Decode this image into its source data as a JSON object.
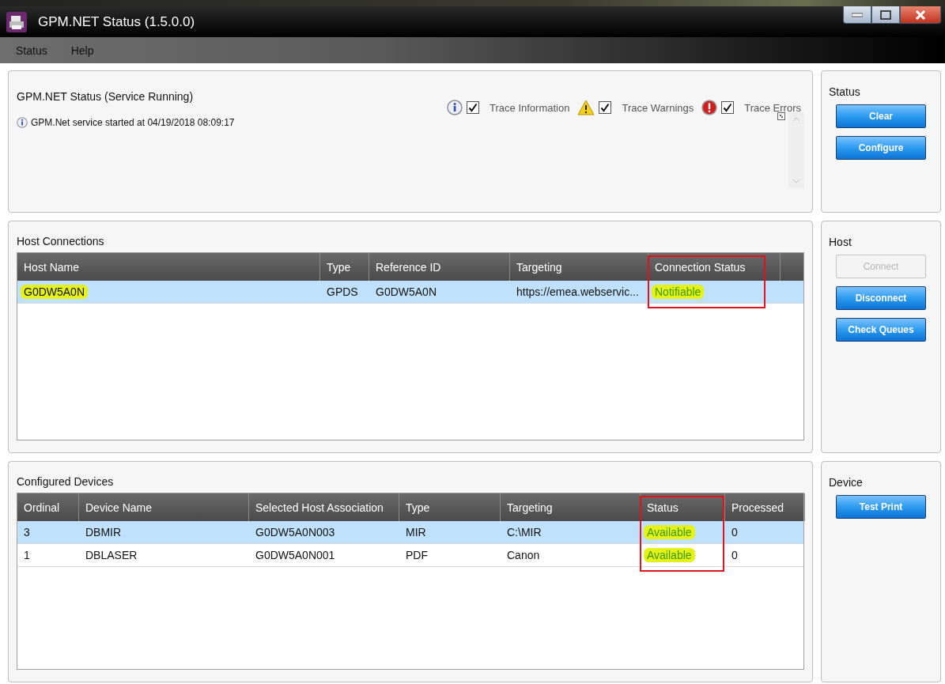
{
  "window": {
    "title": "GPM.NET Status (1.5.0.0)"
  },
  "menu": [
    "Status",
    "Help"
  ],
  "status_panel": {
    "title": "GPM.NET Status (Service Running)",
    "traces": [
      {
        "kind": "info",
        "label": "Trace Information",
        "checked": true
      },
      {
        "kind": "warning",
        "label": "Trace Warnings",
        "checked": true
      },
      {
        "kind": "error",
        "label": "Trace Errors",
        "checked": true
      }
    ],
    "log": [
      {
        "kind": "info",
        "text": "GPM.Net service started at 04/19/2018 08:09:17"
      }
    ]
  },
  "status_actions": {
    "title": "Status",
    "buttons": [
      {
        "label": "Clear",
        "disabled": false
      },
      {
        "label": "Configure",
        "disabled": false
      }
    ]
  },
  "host_connections": {
    "title": "Host Connections",
    "columns": [
      {
        "label": "Host Name",
        "marked": false
      },
      {
        "label": "Type",
        "marked": false
      },
      {
        "label": "Reference ID",
        "marked": false
      },
      {
        "label": "Targeting",
        "marked": false
      },
      {
        "label": "Connection Status",
        "marked": true
      }
    ],
    "rows": [
      {
        "cells": [
          "G0DW5A0N",
          "GPDS",
          "G0DW5A0N",
          "https://emea.webservic...",
          "Notifiable"
        ],
        "selected": true,
        "highlighted": [
          true,
          false,
          false,
          false,
          true
        ]
      }
    ]
  },
  "host_actions": {
    "title": "Host",
    "buttons": [
      {
        "label": "Connect",
        "disabled": true
      },
      {
        "label": "Disconnect",
        "disabled": false
      },
      {
        "label": "Check Queues",
        "disabled": false
      }
    ]
  },
  "configured_devices": {
    "title": "Configured Devices",
    "columns": [
      {
        "label": "Ordinal",
        "marked": false
      },
      {
        "label": "Device Name",
        "marked": false
      },
      {
        "label": "Selected Host Association",
        "marked": false
      },
      {
        "label": "Type",
        "marked": false
      },
      {
        "label": "Targeting",
        "marked": false
      },
      {
        "label": "Status",
        "marked": true
      },
      {
        "label": "Processed",
        "marked": false
      }
    ],
    "rows": [
      {
        "cells": [
          "3",
          "DBMIR",
          "G0DW5A0N003",
          "MIR",
          "C:\\MIR",
          "Available",
          "0"
        ],
        "selected": true,
        "highlighted": [
          false,
          false,
          false,
          false,
          false,
          true,
          false
        ]
      },
      {
        "cells": [
          "1",
          "DBLASER",
          "G0DW5A0N001",
          "PDF",
          "Canon",
          "Available",
          "0"
        ],
        "selected": false,
        "highlighted": [
          false,
          false,
          false,
          false,
          false,
          true,
          false
        ]
      }
    ]
  },
  "device_actions": {
    "title": "Device",
    "buttons": [
      {
        "label": "Test Print",
        "disabled": false
      }
    ]
  }
}
